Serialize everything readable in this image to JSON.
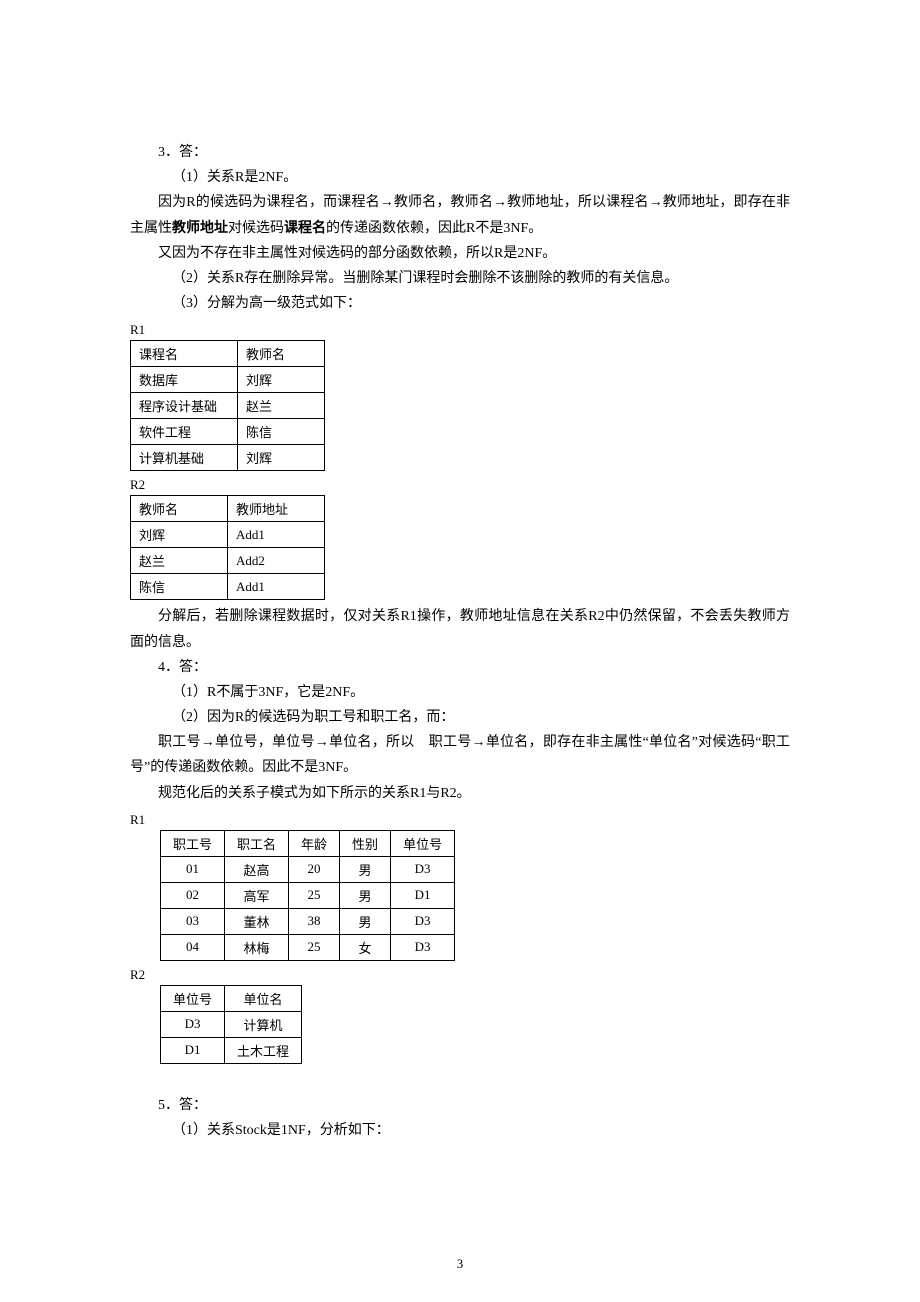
{
  "q3": {
    "heading": "3．答：",
    "p1": "（1）关系R是2NF。",
    "p2a": "因为R的候选码为课程名，而课程名→教师名，教师名→教师地址，所以课程名→教师地址，即存在非主属性",
    "p2_bold1": "教师地址",
    "p2b": "对候选码",
    "p2_bold2": "课程名",
    "p2c": "的传递函数依赖，因此R不是3NF。",
    "p3": "又因为不存在非主属性对候选码的部分函数依赖，所以R是2NF。",
    "p4": "（2）关系R存在删除异常。当删除某门课程时会删除不该删除的教师的有关信息。",
    "p5": "（3）分解为高一级范式如下：",
    "r1_label": "R1",
    "r1": {
      "headers": [
        "课程名",
        "教师名"
      ],
      "rows": [
        [
          "数据库",
          "刘辉"
        ],
        [
          "程序设计基础",
          "赵兰"
        ],
        [
          "软件工程",
          "陈信"
        ],
        [
          "计算机基础",
          "刘辉"
        ]
      ]
    },
    "r2_label": "R2",
    "r2": {
      "headers": [
        "教师名",
        "教师地址"
      ],
      "rows": [
        [
          "刘辉",
          "Add1"
        ],
        [
          "赵兰",
          "Add2"
        ],
        [
          "陈信",
          "Add1"
        ]
      ]
    },
    "p6": "分解后，若删除课程数据时，仅对关系R1操作，教师地址信息在关系R2中仍然保留，不会丢失教师方面的信息。"
  },
  "q4": {
    "heading": "4．答：",
    "p1": "（1）R不属于3NF，它是2NF。",
    "p2": "（2）因为R的候选码为职工号和职工名，而：",
    "p3": "职工号→单位号，单位号→单位名，所以　职工号→单位名，即存在非主属性“单位名”对候选码“职工号”的传递函数依赖。因此不是3NF。",
    "p4": "规范化后的关系子模式为如下所示的关系R1与R2。",
    "r1_label": "R1",
    "r1": {
      "headers": [
        "职工号",
        "职工名",
        "年龄",
        "性别",
        "单位号"
      ],
      "rows": [
        [
          "01",
          "赵高",
          "20",
          "男",
          "D3"
        ],
        [
          "02",
          "高军",
          "25",
          "男",
          "D1"
        ],
        [
          "03",
          "董林",
          "38",
          "男",
          "D3"
        ],
        [
          "04",
          "林梅",
          "25",
          "女",
          "D3"
        ]
      ]
    },
    "r2_label": "R2",
    "r2": {
      "headers": [
        "单位号",
        "单位名"
      ],
      "rows": [
        [
          "D3",
          "计算机"
        ],
        [
          "D1",
          "土木工程"
        ]
      ]
    }
  },
  "q5": {
    "heading": "5．答：",
    "p1": "（1）关系Stock是1NF，分析如下："
  },
  "page_number": "3"
}
